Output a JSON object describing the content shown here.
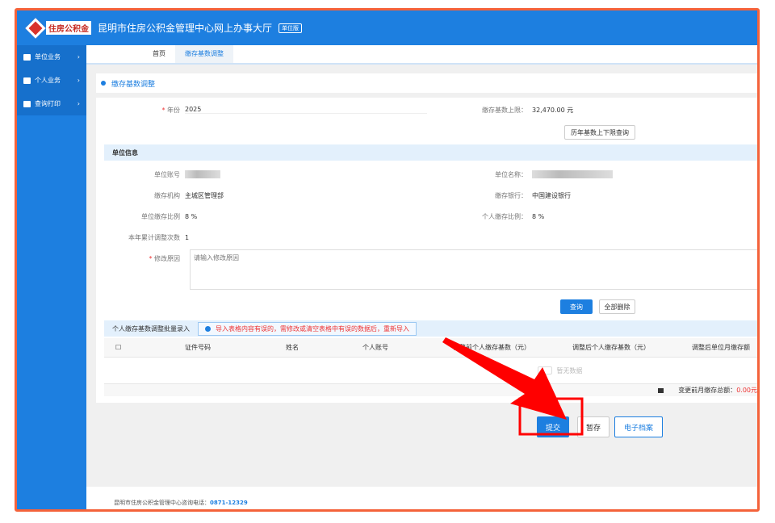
{
  "header": {
    "logo_text": "住房公积金",
    "title": "昆明市住房公积金管理中心网上办事大厅",
    "badge": "单位版"
  },
  "sidebar": {
    "items": [
      {
        "label": "单位业务"
      },
      {
        "label": "个人业务"
      },
      {
        "label": "查询打印"
      }
    ]
  },
  "tabs": [
    {
      "label": "首页"
    },
    {
      "label": "缴存基数调整"
    }
  ],
  "breadcrumb": "缴存基数调整",
  "form": {
    "year_label": "年份",
    "year_value": "2025",
    "cap_label": "缴存基数上限：",
    "cap_value": "32,470.00 元",
    "history_button": "历年基数上下限查询",
    "section_title": "单位信息",
    "unit_account_label": "单位账号",
    "unit_name_label": "单位名称：",
    "agency_label": "缴存机构",
    "agency_value": "主城区管理部",
    "bank_label": "缴存银行：",
    "bank_value": "中国建设银行",
    "unit_ratio_label": "单位缴存比例",
    "unit_ratio_value": "8 %",
    "personal_ratio_label": "个人缴存比例：",
    "personal_ratio_value": "8 %",
    "adjust_count_label": "本年累计调整次数",
    "adjust_count_value": "1",
    "reason_label": "修改原因",
    "reason_placeholder": "请输入修改原因",
    "query_button": "查询",
    "delete_all_button": "全部删除"
  },
  "batch": {
    "title": "个人缴存基数调整批量录入",
    "notice": "导入表格内容有误的，需修改或清空表格中有误的数据后，重新导入",
    "columns": [
      "证件号码",
      "姓名",
      "个人账号",
      "调整前个人缴存基数（元）",
      "调整后个人缴存基数（元）",
      "调整后单位月缴存额"
    ],
    "empty": "暂无数据",
    "total_label": "变更前月缴存总额：",
    "total_value": "0.00元"
  },
  "actions": {
    "submit": "提交",
    "save": "暂存",
    "archive": "电子档案"
  },
  "footer": {
    "text": "昆明市住房公积金管理中心咨询电话：",
    "phone": "0871-12329"
  },
  "colors": {
    "primary": "#1d7fe0",
    "annotation": "#ff0000"
  }
}
